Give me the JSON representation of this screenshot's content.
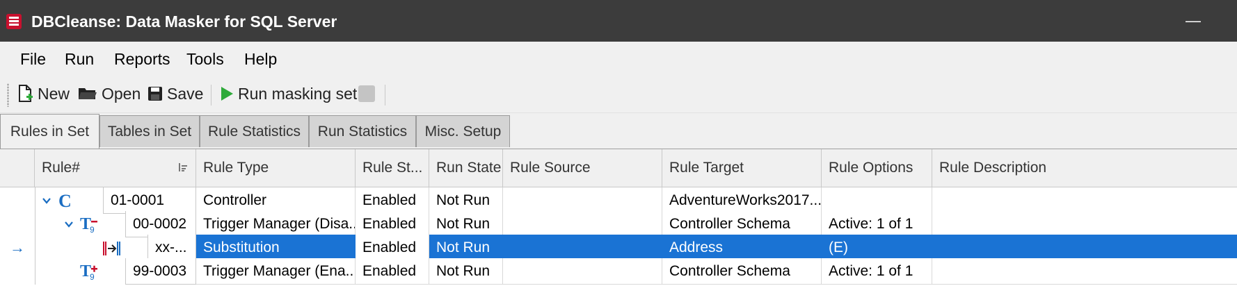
{
  "window": {
    "title": "DBCleanse: Data Masker for SQL Server",
    "minimize_symbol": "—"
  },
  "menu": [
    "File",
    "Run",
    "Reports",
    "Tools",
    "Help"
  ],
  "toolbar": {
    "new_label": "New",
    "open_label": "Open",
    "save_label": "Save",
    "run_label": "Run masking set"
  },
  "tabs": [
    {
      "label": "Rules in Set",
      "active": true
    },
    {
      "label": "Tables in Set",
      "active": false
    },
    {
      "label": "Rule Statistics",
      "active": false
    },
    {
      "label": "Run Statistics",
      "active": false
    },
    {
      "label": "Misc. Setup",
      "active": false
    }
  ],
  "grid": {
    "headers": [
      "Rule#",
      "Rule Type",
      "Rule St...",
      "Run State",
      "Rule Source",
      "Rule Target",
      "Rule Options",
      "Rule Description"
    ],
    "rows": [
      {
        "icon": "controller-icon",
        "num": "01-0001",
        "type": "Controller",
        "status": "Enabled",
        "run_state": "Not Run",
        "source": "",
        "target": "AdventureWorks2017...",
        "options": "",
        "description": ""
      },
      {
        "icon": "trigger-manager-disable-icon",
        "num": "00-0002",
        "type": "Trigger Manager (Disa...",
        "status": "Enabled",
        "run_state": "Not Run",
        "source": "",
        "target": "Controller Schema",
        "options": "Active: 1 of 1",
        "description": ""
      },
      {
        "icon": "substitution-icon",
        "num": "xx-...",
        "type": "Substitution",
        "status": "Enabled",
        "run_state": "Not Run",
        "source": "",
        "target": "Address",
        "options": "(E)",
        "description": "",
        "selected": true,
        "row_indicator": "→"
      },
      {
        "icon": "trigger-manager-enable-icon",
        "num": "99-0003",
        "type": "Trigger Manager (Ena...",
        "status": "Enabled",
        "run_state": "Not Run",
        "source": "",
        "target": "Controller Schema",
        "options": "Active: 1 of 1",
        "description": ""
      }
    ]
  },
  "colors": {
    "title_bar": "#3c3c3c",
    "selection": "#1a73d4",
    "tree_icon_blue": "#1a6dc2",
    "run_green": "#2eaa3a",
    "brand_red": "#c8102e"
  }
}
